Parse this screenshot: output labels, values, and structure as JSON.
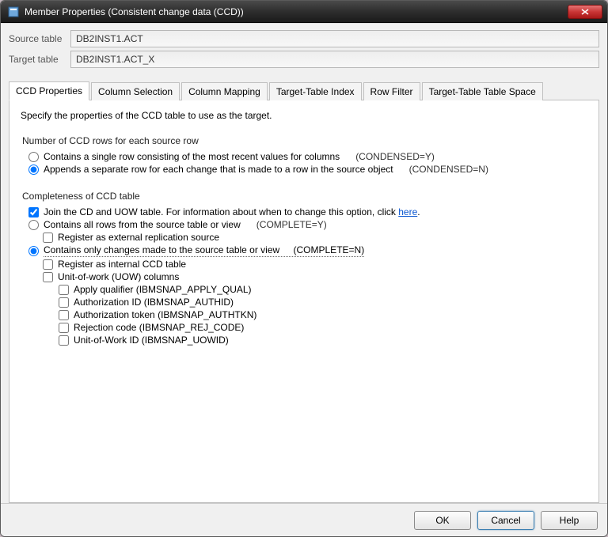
{
  "window": {
    "title": "Member Properties (Consistent change data (CCD))"
  },
  "fields": {
    "source_label": "Source table",
    "source_value": "DB2INST1.ACT",
    "target_label": "Target table",
    "target_value": "DB2INST1.ACT_X"
  },
  "tabs": [
    {
      "label": "CCD Properties",
      "active": true
    },
    {
      "label": "Column Selection",
      "active": false
    },
    {
      "label": "Column Mapping",
      "active": false
    },
    {
      "label": "Target-Table Index",
      "active": false
    },
    {
      "label": "Row Filter",
      "active": false
    },
    {
      "label": "Target-Table Table Space",
      "active": false
    }
  ],
  "ccd": {
    "intro": "Specify the properties of the CCD table to use as the target.",
    "rows_group": "Number of CCD rows for each source row",
    "rows_opt1": "Contains a single row consisting of the most recent values for columns",
    "rows_opt1_suffix": "(CONDENSED=Y)",
    "rows_opt2": "Appends a separate row for each change that is made to a row in the source object",
    "rows_opt2_suffix": "(CONDENSED=N)",
    "rows_selected": "opt2",
    "complete_group": "Completeness of CCD table",
    "join_label_pre": "Join the CD and UOW table.  For information about when to change this option, click ",
    "join_link": "here",
    "join_label_post": ".",
    "join_checked": true,
    "complete_opt1": "Contains all rows from the source table or view",
    "complete_opt1_suffix": "(COMPLETE=Y)",
    "register_ext": "Register as external replication source",
    "complete_opt2": "Contains only changes made to the source table or view",
    "complete_opt2_suffix": "(COMPLETE=N)",
    "complete_selected": "opt2",
    "register_int": "Register as internal CCD table",
    "uow_cols": "Unit-of-work (UOW) columns",
    "uow_children": [
      "Apply qualifier (IBMSNAP_APPLY_QUAL)",
      "Authorization ID (IBMSNAP_AUTHID)",
      "Authorization token (IBMSNAP_AUTHTKN)",
      "Rejection code (IBMSNAP_REJ_CODE)",
      "Unit-of-Work ID (IBMSNAP_UOWID)"
    ]
  },
  "buttons": {
    "ok": "OK",
    "cancel": "Cancel",
    "help": "Help"
  }
}
